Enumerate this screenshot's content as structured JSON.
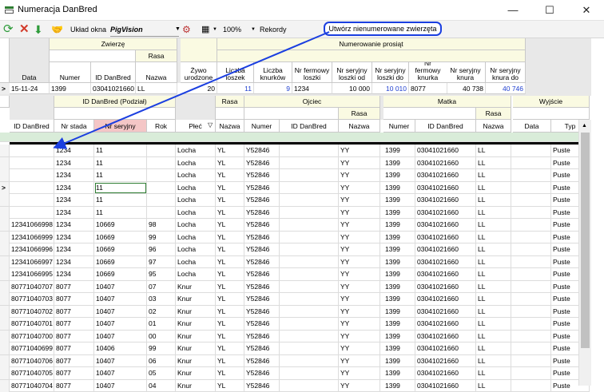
{
  "window": {
    "title": "Numeracja DanBred",
    "minimize": "—",
    "maximize": "☐",
    "close": "✕"
  },
  "toolbar": {
    "layout_label": "Układ okna",
    "layout_value": "PigVision",
    "zoom": "100%",
    "records_label": "Rekordy",
    "callout": "Utwórz nienumerowane zwierzęta"
  },
  "top": {
    "groups": {
      "zwierze": "Zwierzę",
      "rasa": "Rasa",
      "numerowanie": "Numerowanie prosiąt"
    },
    "headers": [
      "Data",
      "Numer",
      "ID DanBred",
      "Nazwa",
      "Żywo urodzone",
      "Liczba loszek",
      "Liczba knurków",
      "Nr fermowy loszki",
      "Nr seryjny loszki od",
      "Nr seryjny loszki do",
      "Nr fermowy knurka",
      "Nr seryjny knura",
      "Nr seryjny knura do"
    ],
    "row": [
      "15-11-24",
      "1399",
      "03041021660",
      "LL",
      "20",
      "11",
      "9",
      "1234",
      "10 000",
      "10 010",
      "8077",
      "40 738",
      "40 746"
    ]
  },
  "bottom": {
    "groups": {
      "id": "ID DanBred (Podział)",
      "rasa": "Rasa",
      "ojciec": "Ojciec",
      "ojciec_rasa": "Rasa",
      "matka": "Matka",
      "matka_rasa": "Rasa",
      "wyjscie": "Wyjście"
    },
    "headers": [
      "ID DanBred",
      "Nr stada",
      "Nr seryjny",
      "Rok",
      "Płeć",
      "Nazwa",
      "Numer",
      "ID DanBred",
      "Nazwa",
      "Numer",
      "ID DanBred",
      "Nazwa",
      "Data",
      "Typ"
    ],
    "rows": [
      [
        "",
        "1234",
        "11",
        "",
        "Locha",
        "YL",
        "Y52846",
        "",
        "YY",
        "1399",
        "03041021660",
        "LL",
        "",
        "Puste"
      ],
      [
        "",
        "1234",
        "11",
        "",
        "Locha",
        "YL",
        "Y52846",
        "",
        "YY",
        "1399",
        "03041021660",
        "LL",
        "",
        "Puste"
      ],
      [
        "",
        "1234",
        "11",
        "",
        "Locha",
        "YL",
        "Y52846",
        "",
        "YY",
        "1399",
        "03041021660",
        "LL",
        "",
        "Puste"
      ],
      [
        "",
        "1234",
        "11",
        "",
        "Locha",
        "YL",
        "Y52846",
        "",
        "YY",
        "1399",
        "03041021660",
        "LL",
        "",
        "Puste"
      ],
      [
        "",
        "1234",
        "11",
        "",
        "Locha",
        "YL",
        "Y52846",
        "",
        "YY",
        "1399",
        "03041021660",
        "LL",
        "",
        "Puste"
      ],
      [
        "",
        "1234",
        "11",
        "",
        "Locha",
        "YL",
        "Y52846",
        "",
        "YY",
        "1399",
        "03041021660",
        "LL",
        "",
        "Puste"
      ],
      [
        "12341066998",
        "1234",
        "10669",
        "98",
        "Locha",
        "YL",
        "Y52846",
        "",
        "YY",
        "1399",
        "03041021660",
        "LL",
        "",
        "Puste"
      ],
      [
        "12341066999",
        "1234",
        "10669",
        "99",
        "Locha",
        "YL",
        "Y52846",
        "",
        "YY",
        "1399",
        "03041021660",
        "LL",
        "",
        "Puste"
      ],
      [
        "12341066996",
        "1234",
        "10669",
        "96",
        "Locha",
        "YL",
        "Y52846",
        "",
        "YY",
        "1399",
        "03041021660",
        "LL",
        "",
        "Puste"
      ],
      [
        "12341066997",
        "1234",
        "10669",
        "97",
        "Locha",
        "YL",
        "Y52846",
        "",
        "YY",
        "1399",
        "03041021660",
        "LL",
        "",
        "Puste"
      ],
      [
        "12341066995",
        "1234",
        "10669",
        "95",
        "Locha",
        "YL",
        "Y52846",
        "",
        "YY",
        "1399",
        "03041021660",
        "LL",
        "",
        "Puste"
      ],
      [
        "80771040707",
        "8077",
        "10407",
        "07",
        "Knur",
        "YL",
        "Y52846",
        "",
        "YY",
        "1399",
        "03041021660",
        "LL",
        "",
        "Puste"
      ],
      [
        "80771040703",
        "8077",
        "10407",
        "03",
        "Knur",
        "YL",
        "Y52846",
        "",
        "YY",
        "1399",
        "03041021660",
        "LL",
        "",
        "Puste"
      ],
      [
        "80771040702",
        "8077",
        "10407",
        "02",
        "Knur",
        "YL",
        "Y52846",
        "",
        "YY",
        "1399",
        "03041021660",
        "LL",
        "",
        "Puste"
      ],
      [
        "80771040701",
        "8077",
        "10407",
        "01",
        "Knur",
        "YL",
        "Y52846",
        "",
        "YY",
        "1399",
        "03041021660",
        "LL",
        "",
        "Puste"
      ],
      [
        "80771040700",
        "8077",
        "10407",
        "00",
        "Knur",
        "YL",
        "Y52846",
        "",
        "YY",
        "1399",
        "03041021660",
        "LL",
        "",
        "Puste"
      ],
      [
        "80771040699",
        "8077",
        "10406",
        "99",
        "Knur",
        "YL",
        "Y52846",
        "",
        "YY",
        "1399",
        "03041021660",
        "LL",
        "",
        "Puste"
      ],
      [
        "80771040706",
        "8077",
        "10407",
        "06",
        "Knur",
        "YL",
        "Y52846",
        "",
        "YY",
        "1399",
        "03041021660",
        "LL",
        "",
        "Puste"
      ],
      [
        "80771040705",
        "8077",
        "10407",
        "05",
        "Knur",
        "YL",
        "Y52846",
        "",
        "YY",
        "1399",
        "03041021660",
        "LL",
        "",
        "Puste"
      ],
      [
        "80771040704",
        "8077",
        "10407",
        "04",
        "Knur",
        "YL",
        "Y52846",
        "",
        "YY",
        "1399",
        "03041021660",
        "LL",
        "",
        "Puste"
      ]
    ]
  },
  "colors": {
    "accent_blue": "#1b3fe0",
    "header_yellow": "#fafae2",
    "highlight_pink": "#f4c6c6",
    "link_blue": "#1f3fd0"
  }
}
